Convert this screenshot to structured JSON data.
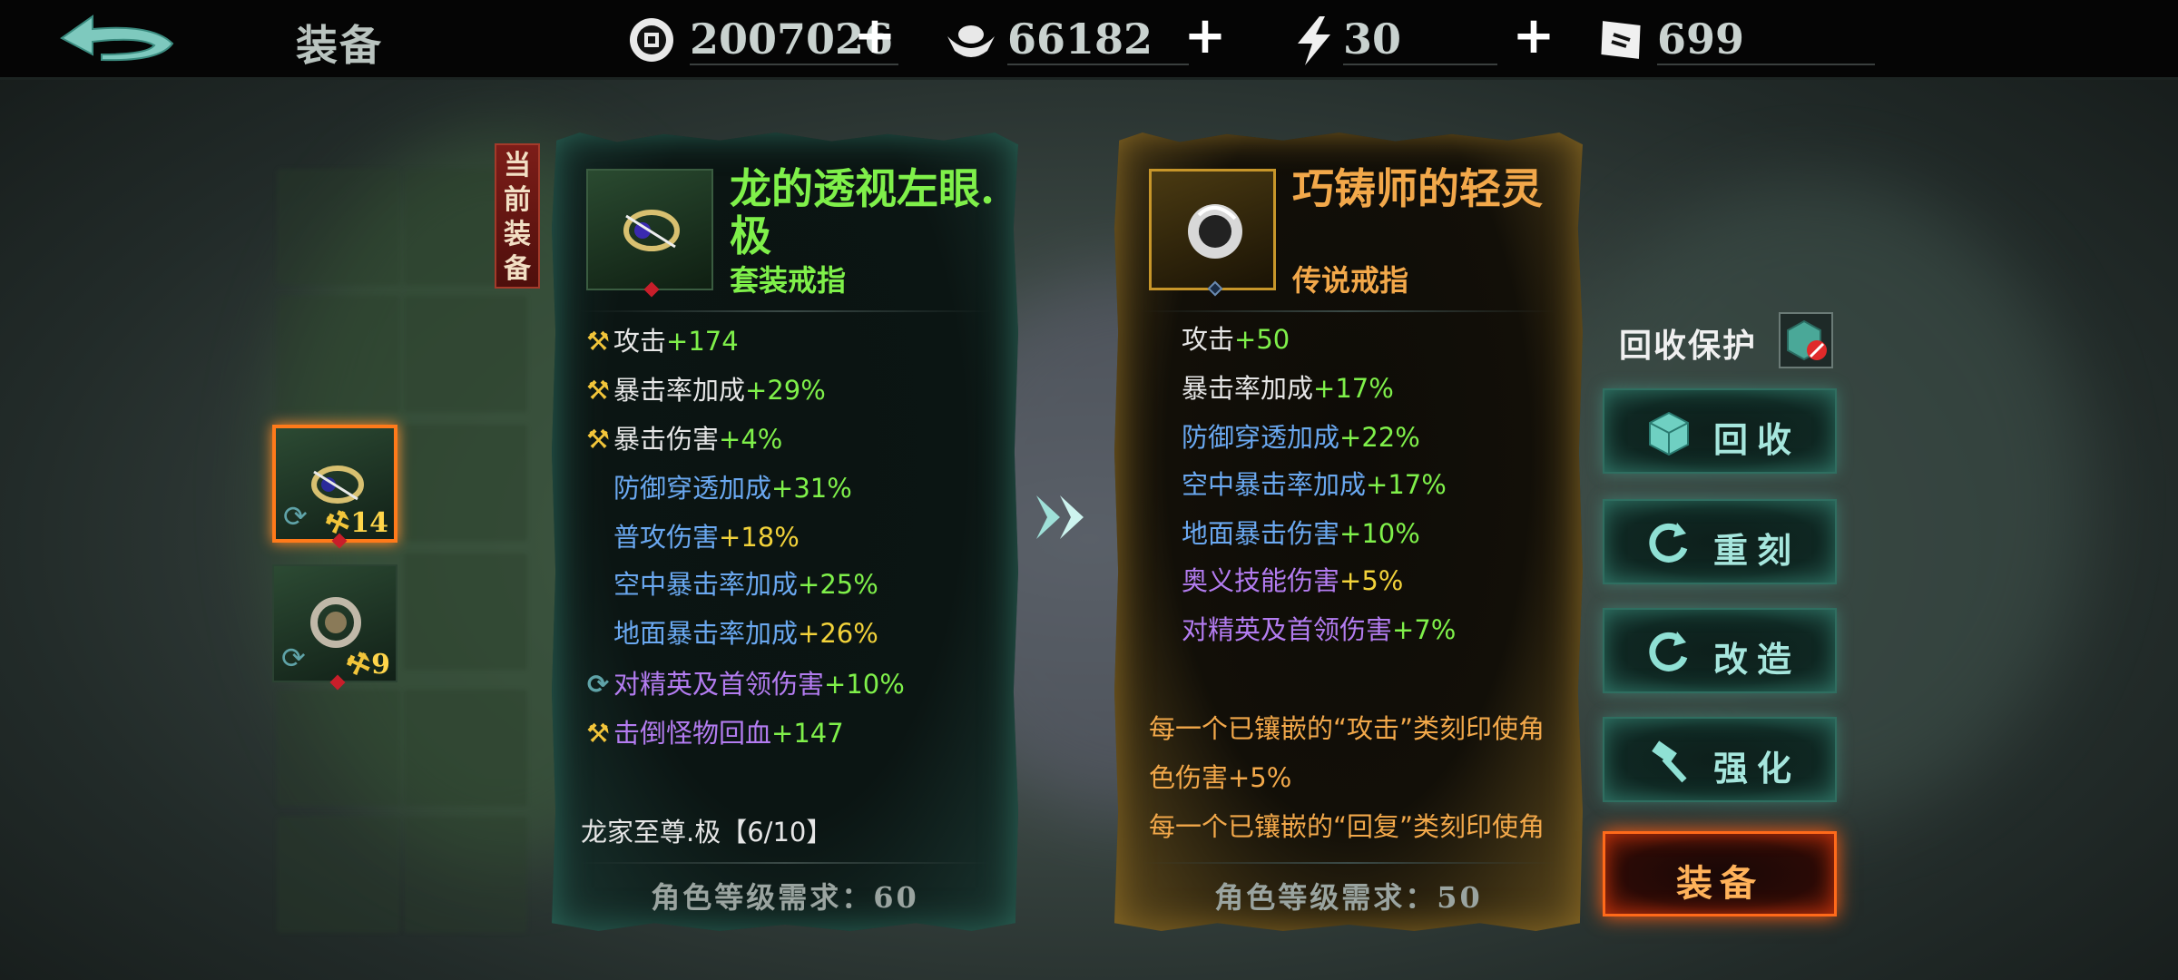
{
  "topbar": {
    "title": "装备",
    "resources": [
      {
        "icon": "coin-icon",
        "value": "2007026"
      },
      {
        "icon": "silver-ingot-icon",
        "value": "66182"
      },
      {
        "icon": "lightning-icon",
        "value": "30"
      },
      {
        "icon": "ticket-icon",
        "value": "699"
      }
    ]
  },
  "inventory": {
    "slots": [
      {
        "level": "14",
        "selected": true,
        "icon": "ring-icon"
      },
      {
        "level": "9",
        "selected": false,
        "icon": "ring-icon"
      }
    ]
  },
  "current_tag": "当前装备",
  "current_item": {
    "name": "龙的透视左眼.极",
    "type": "套装戒指",
    "stats": [
      {
        "icon": "hammer-icon",
        "name": "攻击",
        "value": "+174"
      },
      {
        "icon": "hammer-icon",
        "name": "暴击率加成",
        "value": "+29%"
      },
      {
        "icon": "hammer-icon",
        "name": "暴击伤害",
        "value": "+4%"
      },
      {
        "icon": "",
        "name": "防御穿透加成",
        "value": "+31%"
      },
      {
        "icon": "",
        "name": "普攻伤害",
        "value": "+18%"
      },
      {
        "icon": "",
        "name": "空中暴击率加成",
        "value": "+25%"
      },
      {
        "icon": "",
        "name": "地面暴击率加成",
        "value": "+26%"
      },
      {
        "icon": "refresh-icon",
        "name": "对精英及首领伤害",
        "value": "+10%"
      },
      {
        "icon": "hammer-icon",
        "name": "击倒怪物回血",
        "value": "+147"
      }
    ],
    "set_text": "龙家至尊.极【6/10】",
    "requirement": "角色等级需求：60"
  },
  "compare_item": {
    "name": "巧铸师的轻灵",
    "type": "传说戒指",
    "stats": [
      {
        "name": "攻击",
        "value": "+50"
      },
      {
        "name": "暴击率加成",
        "value": "+17%"
      },
      {
        "name": "防御穿透加成",
        "value": "+22%"
      },
      {
        "name": "空中暴击率加成",
        "value": "+17%"
      },
      {
        "name": "地面暴击伤害",
        "value": "+10%"
      },
      {
        "name": "奥义技能伤害",
        "value": "+5%"
      },
      {
        "name": "对精英及首领伤害",
        "value": "+7%"
      }
    ],
    "desc_lines": [
      "每一个已镶嵌的“攻击”类刻印使角",
      "色伤害+5%",
      "每一个已镶嵌的“回复”类刻印使角"
    ],
    "requirement": "角色等级需求：50"
  },
  "actions": {
    "protect_label": "回收保护",
    "recycle": "回收",
    "reforge": "重刻",
    "modify": "改造",
    "enhance": "强化",
    "equip": "装备"
  },
  "colors": {
    "set_name": "#7ff04a",
    "legend_name": "#f2a84a",
    "equip_glow": "#ff5a10",
    "button_teal": "#a6e6dd"
  }
}
